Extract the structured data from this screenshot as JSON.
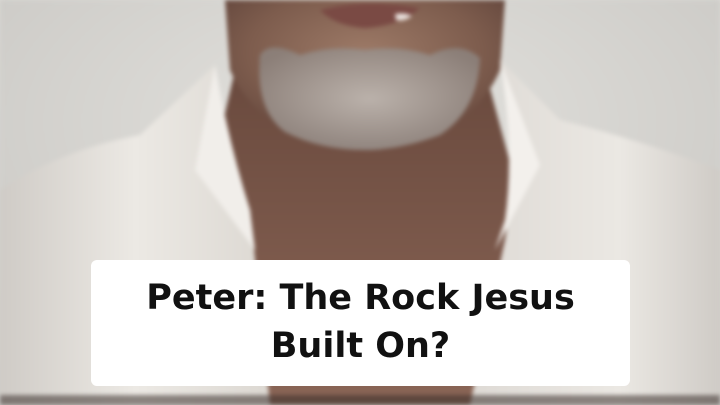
{
  "caption": {
    "line1": "Peter: The Rock Jesus",
    "line2": "Built On?"
  },
  "colors": {
    "background_wall": "#d6d5d1",
    "shirt": "#e6e3de",
    "skin": "#8c6a5a",
    "beard": "#a9a29c",
    "caption_box": "#ffffff",
    "caption_text": "#111111"
  }
}
